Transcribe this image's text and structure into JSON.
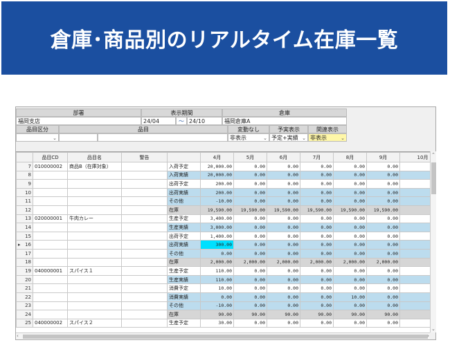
{
  "banner": {
    "title": "倉庫･商品別のリアルタイム在庫一覧"
  },
  "filters": {
    "dept_label": "部署",
    "dept_value": "福岡支店",
    "period_label": "表示期間",
    "period_from": "24/04",
    "period_sep": "～",
    "period_to": "24/10",
    "warehouse_label": "倉庫",
    "warehouse_value": "福岡倉庫A",
    "category_label": "品目区分",
    "item_label": "品目",
    "change_label": "変動なし",
    "change_value": "非表示",
    "forecast_label": "予実表示",
    "forecast_value": "予定+実績",
    "related_label": "関連表示",
    "related_value": "非表示"
  },
  "columns": {
    "code": "品目CD",
    "name": "品目名",
    "warning": "警告",
    "months": [
      "4月",
      "5月",
      "6月",
      "7月",
      "8月",
      "9月",
      "10月"
    ]
  },
  "rows": [
    {
      "no": "7",
      "code": "010000002",
      "name": "商品B（在庫対象）",
      "sub": "入荷予定",
      "vals": [
        "20,000.00",
        "0.00",
        "0.00",
        "0.00",
        "0.00",
        "0.00",
        "0"
      ],
      "style": ""
    },
    {
      "no": "8",
      "code": "",
      "name": "",
      "sub": "入荷実績",
      "vals": [
        "20,000.00",
        "0.00",
        "0.00",
        "0.00",
        "0.00",
        "0.00",
        "0"
      ],
      "style": "blue"
    },
    {
      "no": "9",
      "code": "",
      "name": "",
      "sub": "出荷予定",
      "vals": [
        "200.00",
        "0.00",
        "0.00",
        "0.00",
        "0.00",
        "0.00",
        "0"
      ],
      "style": ""
    },
    {
      "no": "10",
      "code": "",
      "name": "",
      "sub": "出荷実績",
      "vals": [
        "200.00",
        "0.00",
        "0.00",
        "0.00",
        "0.00",
        "0.00",
        "0"
      ],
      "style": "blue"
    },
    {
      "no": "11",
      "code": "",
      "name": "",
      "sub": "その他",
      "vals": [
        "-10.00",
        "0.00",
        "0.00",
        "0.00",
        "0.00",
        "0.00",
        "0"
      ],
      "style": "blue"
    },
    {
      "no": "12",
      "code": "",
      "name": "",
      "sub": "在庫",
      "vals": [
        "19,590.00",
        "19,590.00",
        "19,590.00",
        "19,590.00",
        "19,590.00",
        "19,590.00",
        "19,59"
      ],
      "style": "total"
    },
    {
      "no": "13",
      "code": "020000001",
      "name": "牛肉カレー",
      "sub": "生産予定",
      "vals": [
        "3,400.00",
        "0.00",
        "0.00",
        "0.00",
        "0.00",
        "0.00",
        "0"
      ],
      "style": ""
    },
    {
      "no": "14",
      "code": "",
      "name": "",
      "sub": "生産実績",
      "vals": [
        "3,000.00",
        "0.00",
        "0.00",
        "0.00",
        "0.00",
        "0.00",
        "0"
      ],
      "style": "blue"
    },
    {
      "no": "15",
      "code": "",
      "name": "",
      "sub": "出荷予定",
      "vals": [
        "1,400.00",
        "0.00",
        "0.00",
        "0.00",
        "0.00",
        "0.00",
        "0"
      ],
      "style": ""
    },
    {
      "no": "16",
      "code": "",
      "name": "",
      "sub": "出荷実績",
      "vals": [
        "300.00",
        "0.00",
        "0.00",
        "0.00",
        "0.00",
        "0.00",
        "0"
      ],
      "style": "blue",
      "cyan": true,
      "current": true
    },
    {
      "no": "17",
      "code": "",
      "name": "",
      "sub": "その他",
      "vals": [
        "0.00",
        "0.00",
        "0.00",
        "0.00",
        "0.00",
        "0.00",
        "0"
      ],
      "style": "blue"
    },
    {
      "no": "18",
      "code": "",
      "name": "",
      "sub": "在庫",
      "vals": [
        "2,000.00",
        "2,000.00",
        "2,000.00",
        "2,000.00",
        "2,000.00",
        "2,000.00",
        "2,00"
      ],
      "style": "total"
    },
    {
      "no": "19",
      "code": "040000001",
      "name": "スパイス１",
      "sub": "生産予定",
      "vals": [
        "110.00",
        "0.00",
        "0.00",
        "0.00",
        "0.00",
        "0.00",
        "0"
      ],
      "style": ""
    },
    {
      "no": "20",
      "code": "",
      "name": "",
      "sub": "生産実績",
      "vals": [
        "110.00",
        "0.00",
        "0.00",
        "0.00",
        "0.00",
        "0.00",
        "0"
      ],
      "style": "blue"
    },
    {
      "no": "21",
      "code": "",
      "name": "",
      "sub": "消費予定",
      "vals": [
        "10.00",
        "0.00",
        "0.00",
        "0.00",
        "0.00",
        "0.00",
        "0"
      ],
      "style": ""
    },
    {
      "no": "22",
      "code": "",
      "name": "",
      "sub": "消費実績",
      "vals": [
        "0.00",
        "0.00",
        "0.00",
        "0.00",
        "10.00",
        "0.00",
        "0"
      ],
      "style": "blue"
    },
    {
      "no": "23",
      "code": "",
      "name": "",
      "sub": "その他",
      "vals": [
        "-10.00",
        "0.00",
        "0.00",
        "0.00",
        "0.00",
        "0.00",
        "0"
      ],
      "style": "blue"
    },
    {
      "no": "24",
      "code": "",
      "name": "",
      "sub": "在庫",
      "vals": [
        "90.00",
        "90.00",
        "90.00",
        "90.00",
        "90.00",
        "90.00",
        "9"
      ],
      "style": "total"
    },
    {
      "no": "25",
      "code": "040000002",
      "name": "スパイス２",
      "sub": "生産予定",
      "vals": [
        "30.00",
        "0.00",
        "0.00",
        "0.00",
        "0.00",
        "0.00",
        "0"
      ],
      "style": ""
    }
  ]
}
